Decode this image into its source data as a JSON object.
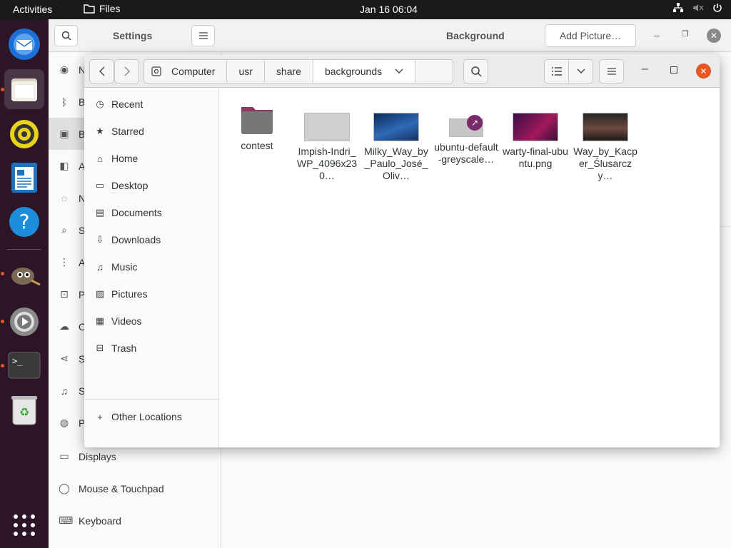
{
  "topbar": {
    "activities": "Activities",
    "app_name": "Files",
    "clock": "Jan 16  06:04"
  },
  "dock": {
    "items": [
      "thunderbird-icon",
      "files-icon",
      "rhythmbox-icon",
      "writer-icon",
      "help-icon",
      "gimp-icon",
      "settings-icon",
      "terminal-icon",
      "trash-icon"
    ],
    "show_apps": "app-grid-icon"
  },
  "settings": {
    "title": "Settings",
    "panel_title": "Background",
    "add_picture": "Add Picture…",
    "sidebar": [
      {
        "icon": "network-icon",
        "label": "N"
      },
      {
        "icon": "bluetooth-icon",
        "label": "B"
      },
      {
        "icon": "background-icon",
        "label": "B"
      },
      {
        "icon": "appearance-icon",
        "label": "A"
      },
      {
        "icon": "notifications-icon",
        "label": "N"
      },
      {
        "icon": "search-icon",
        "label": "S"
      },
      {
        "icon": "applications-icon",
        "label": "A"
      },
      {
        "icon": "privacy-icon",
        "label": "P"
      },
      {
        "icon": "online-accounts-icon",
        "label": "O"
      },
      {
        "icon": "sharing-icon",
        "label": "S"
      },
      {
        "icon": "sound-icon",
        "label": "S"
      },
      {
        "icon": "power-icon",
        "label": "P"
      },
      {
        "icon": "displays-icon",
        "label": "Displays"
      },
      {
        "icon": "mouse-icon",
        "label": "Mouse & Touchpad"
      },
      {
        "icon": "keyboard-icon",
        "label": "Keyboard"
      }
    ]
  },
  "files": {
    "path": [
      "Computer",
      "usr",
      "share",
      "backgrounds"
    ],
    "places": [
      {
        "icon": "recent-icon",
        "label": "Recent"
      },
      {
        "icon": "starred-icon",
        "label": "Starred"
      },
      {
        "icon": "home-icon",
        "label": "Home"
      },
      {
        "icon": "desktop-icon",
        "label": "Desktop"
      },
      {
        "icon": "documents-icon",
        "label": "Documents"
      },
      {
        "icon": "downloads-icon",
        "label": "Downloads"
      },
      {
        "icon": "music-icon",
        "label": "Music"
      },
      {
        "icon": "pictures-icon",
        "label": "Pictures"
      },
      {
        "icon": "videos-icon",
        "label": "Videos"
      },
      {
        "icon": "trash-icon",
        "label": "Trash"
      }
    ],
    "other_locations": "Other Locations",
    "items": [
      {
        "name": "contest",
        "kind": "folder"
      },
      {
        "name": "Impish-Indri_WP_4096x230…",
        "kind": "image",
        "color": "#d0d0d0"
      },
      {
        "name": "Milky_Way_by_Paulo_José_Oliv…",
        "kind": "image",
        "color": "#1f4a8c"
      },
      {
        "name": "ubuntu-default-greyscale…",
        "kind": "link",
        "color": "#bdbdbd"
      },
      {
        "name": "warty-final-ubuntu.png",
        "kind": "image",
        "color": "#6a1a5a"
      },
      {
        "name": "Way_by_Kacper_Ślusarczy…",
        "kind": "image",
        "color": "#3a2a2a"
      }
    ]
  }
}
